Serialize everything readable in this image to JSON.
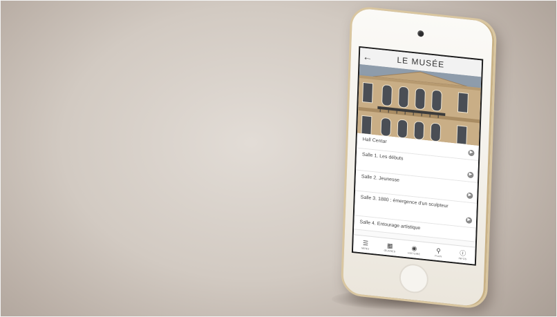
{
  "app": {
    "header_title": "LE MUSÉE",
    "back_icon": "arrow-left-icon"
  },
  "menu": {
    "items": [
      {
        "label": "Hall Centar"
      },
      {
        "label": "Salle 1. Les débuts"
      },
      {
        "label": "Salle 2. Jeunesse"
      },
      {
        "label": "Salle 3. 1880 : émergence d'un sculpteur"
      },
      {
        "label": "Salle 4. Entourage artistique"
      }
    ]
  },
  "tabbar": {
    "tabs": [
      {
        "label": "MENU",
        "icon": "list-icon"
      },
      {
        "label": "ŒUVRES",
        "icon": "grid-icon"
      },
      {
        "label": "HISTOIRE",
        "icon": "compass-icon"
      },
      {
        "label": "PLAN",
        "icon": "location-pin-icon"
      },
      {
        "label": "INFOS",
        "icon": "info-icon"
      }
    ]
  },
  "colors": {
    "frame_gold": "#d9c6a0",
    "screen_bg": "#ffffff",
    "header_bg": "#f2f2f2"
  }
}
